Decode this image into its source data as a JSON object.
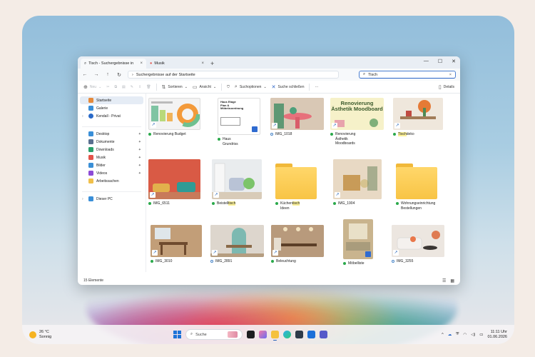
{
  "tabs": [
    {
      "label": "Tisch - Suchergebnisse in",
      "active": true
    },
    {
      "label": "Musik",
      "active": false
    }
  ],
  "window_controls": {
    "minimize": "—",
    "maximize": "☐",
    "close": "✕"
  },
  "nav": {
    "back": "←",
    "forward": "→",
    "up": "↑",
    "refresh": "↻",
    "address": "Suchergebnisse auf der Startseite",
    "search_value": "Tisch"
  },
  "toolbar": {
    "new": "Neu",
    "sort": "Sortieren",
    "view": "Ansicht",
    "search_options": "Suchoptionen",
    "close_search": "Suche schließen",
    "more": "···",
    "details": "Details"
  },
  "sidebar": {
    "pinned_top": [
      {
        "label": "Startseite",
        "icon": "home-icon",
        "color": "#e58a3b",
        "active": true
      },
      {
        "label": "Galerie",
        "icon": "gallery-icon",
        "color": "#3a8fd8"
      },
      {
        "label": "Kendall - Privat",
        "icon": "onedrive-icon",
        "color": "#2a6ac8",
        "chevron": "›"
      }
    ],
    "quick": [
      {
        "label": "Desktop",
        "icon": "desktop-icon",
        "color": "#3a8fd8"
      },
      {
        "label": "Dokumente",
        "icon": "documents-icon",
        "color": "#5a6f8f"
      },
      {
        "label": "Downloads",
        "icon": "downloads-icon",
        "color": "#2aa06b"
      },
      {
        "label": "Musik",
        "icon": "music-icon",
        "color": "#e3534a"
      },
      {
        "label": "Bilder",
        "icon": "pictures-icon",
        "color": "#3b8fd6"
      },
      {
        "label": "Videos",
        "icon": "videos-icon",
        "color": "#8d4bd6"
      },
      {
        "label": "Arbeitssachen",
        "icon": "folder-icon",
        "color": "#f1c04a"
      }
    ],
    "pc": {
      "label": "Dieser PC",
      "icon": "pc-icon",
      "color": "#3a8fd8",
      "chevron": "›"
    }
  },
  "items": [
    {
      "name": "Renovierung Budget",
      "lines": [
        "Renovierung",
        "Budget"
      ],
      "status": "synced",
      "shortcut": true
    },
    {
      "name": "Haus Etage Plan & Möbelzuordnung",
      "lines": [
        "Haus",
        "Grundriss"
      ],
      "status": "synced",
      "shortcut": false,
      "thumb_text": "Haus Etage Plan & Möbelzuordnung"
    },
    {
      "name": "IMG_1018",
      "lines": [
        "IMG_1018"
      ],
      "status": "cloud",
      "shortcut": true
    },
    {
      "name": "Renovierung Ästhetik Moodboards",
      "lines": [
        "Renovierung",
        "Ästhetik",
        "Moodboards"
      ],
      "status": "synced",
      "shortcut": true,
      "thumb_text": "Renovierung Ästhetik Moodboard"
    },
    {
      "name": "Tischdeko",
      "lines": [
        "Tischdeko"
      ],
      "status": "synced",
      "shortcut": true,
      "highlight": "Tisch"
    },
    {
      "name": "IMG_6511",
      "lines": [
        "IMG_6511"
      ],
      "status": "synced",
      "shortcut": true
    },
    {
      "name": "Beistelltisch",
      "lines": [
        "Beistelltisch"
      ],
      "status": "synced",
      "shortcut": true,
      "highlight": "tisch"
    },
    {
      "name": "Küchentisch Ideen",
      "lines": [
        "Küchentisch",
        "Ideen"
      ],
      "status": "synced",
      "shortcut": false,
      "highlight": "tisch"
    },
    {
      "name": "IMG_1904",
      "lines": [
        "IMG_1904"
      ],
      "status": "synced",
      "shortcut": true
    },
    {
      "name": "Wohnungseinrichtung Bestellungen",
      "lines": [
        "Wohnungseinrichtung",
        "Bestellungen"
      ],
      "status": "synced",
      "shortcut": false
    },
    {
      "name": "IMG_3010",
      "lines": [
        "IMG_3010"
      ],
      "status": "synced",
      "shortcut": true
    },
    {
      "name": "IMG_2891",
      "lines": [
        "IMG_2891"
      ],
      "status": "cloud",
      "shortcut": true
    },
    {
      "name": "Beleuchtung",
      "lines": [
        "Beleuchtung"
      ],
      "status": "synced",
      "shortcut": true
    },
    {
      "name": "Möbelliste",
      "lines": [
        "Möbelliste"
      ],
      "status": "synced",
      "shortcut": false
    },
    {
      "name": "IMG_3255",
      "lines": [
        "IMG_3255"
      ],
      "status": "cloud",
      "shortcut": true
    }
  ],
  "status": {
    "count": "15",
    "unit": "Elemente"
  },
  "taskbar": {
    "weather_temp": "26 °C",
    "weather_desc": "Sonnig",
    "search_label": "Suche",
    "time": "11:11 Uhr",
    "date": "01.06.2026",
    "tray_chevron": "^"
  }
}
